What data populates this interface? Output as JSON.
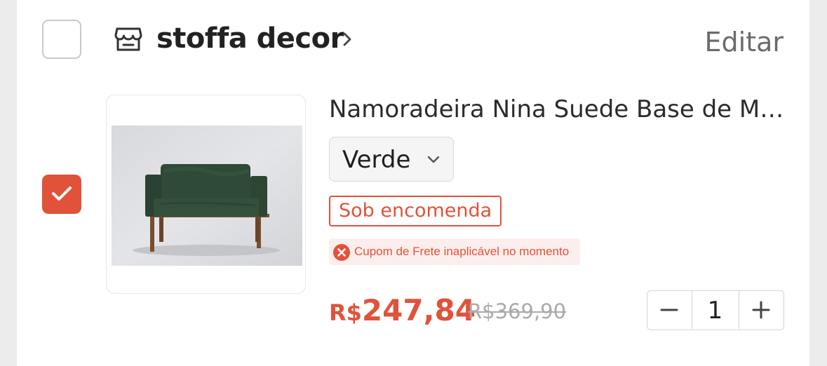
{
  "shop": {
    "name": "stoffa decor",
    "edit_label": "Editar",
    "checked": false
  },
  "item": {
    "checked": true,
    "title": "Namoradeira Nina Suede Base de M…",
    "variant": "Verde",
    "badge": "Sob encomenda",
    "warning": "Cupom de Frete inaplicável no momento",
    "price_currency": "R$",
    "price_value": "247,84",
    "old_price": "R$369,90",
    "quantity": "1"
  },
  "colors": {
    "accent": "#e0533a",
    "text": "#222222",
    "muted": "#6b6b6b",
    "old_price": "#aaaaaa",
    "warning_bg": "#fdeeee"
  },
  "icons": {
    "store": "store-icon",
    "chevron": "chevron-right-icon",
    "dropdown": "chevron-down-icon",
    "warning": "error-circle-icon",
    "check": "check-icon",
    "minus": "minus-icon",
    "plus": "plus-icon"
  }
}
